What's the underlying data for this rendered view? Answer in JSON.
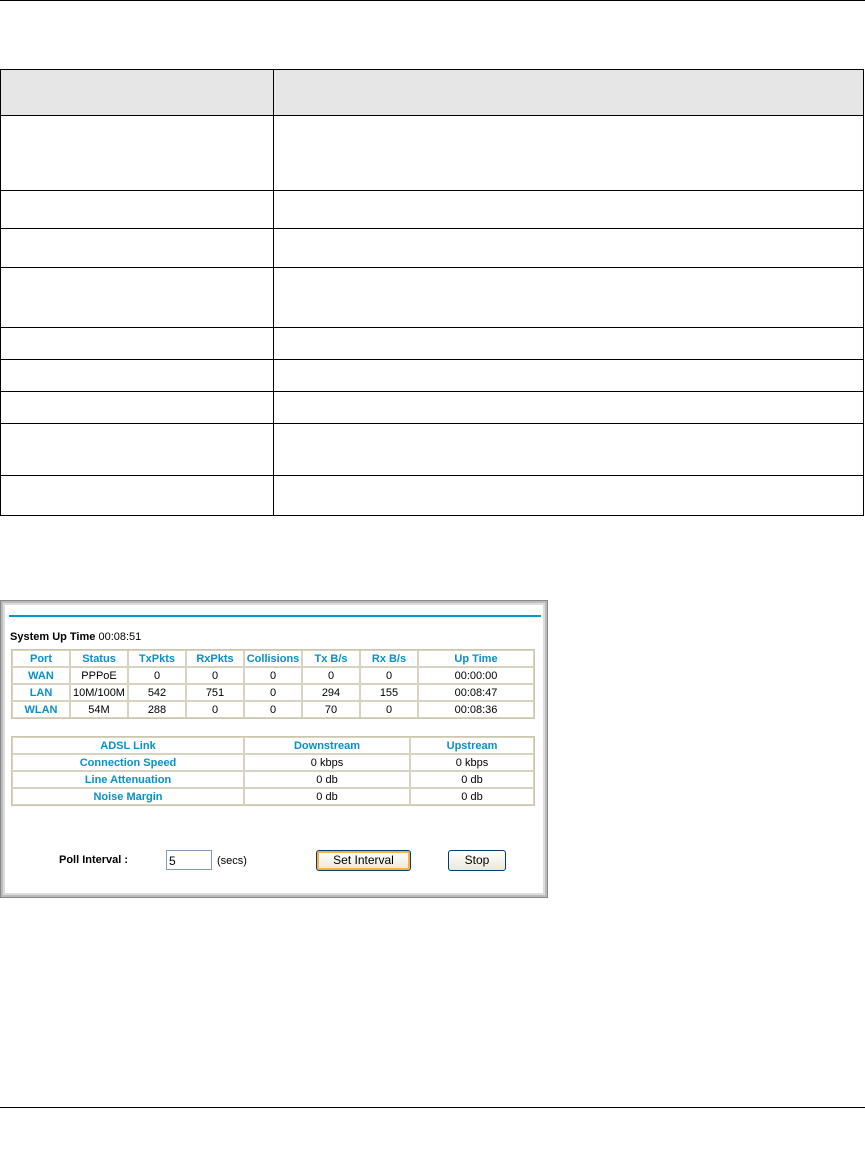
{
  "doc_table": {
    "rows": [
      [
        "",
        ""
      ],
      [
        "",
        ""
      ],
      [
        "",
        ""
      ],
      [
        "",
        ""
      ],
      [
        "",
        ""
      ],
      [
        "",
        ""
      ],
      [
        "",
        ""
      ],
      [
        "",
        ""
      ],
      [
        "",
        ""
      ],
      [
        "",
        ""
      ]
    ]
  },
  "screen": {
    "uptime_label": "System Up Time",
    "uptime_value": "00:08:51",
    "ports": {
      "headers": [
        "Port",
        "Status",
        "TxPkts",
        "RxPkts",
        "Collisions",
        "Tx B/s",
        "Rx B/s",
        "Up Time"
      ],
      "rows": [
        [
          "WAN",
          "PPPoE",
          "0",
          "0",
          "0",
          "0",
          "0",
          "00:00:00"
        ],
        [
          "LAN",
          "10M/100M",
          "542",
          "751",
          "0",
          "294",
          "155",
          "00:08:47"
        ],
        [
          "WLAN",
          "54M",
          "288",
          "0",
          "0",
          "70",
          "0",
          "00:08:36"
        ]
      ]
    },
    "adsl": {
      "headers": [
        "ADSL Link",
        "Downstream",
        "Upstream"
      ],
      "rows": [
        [
          "Connection Speed",
          "0 kbps",
          "0 kbps"
        ],
        [
          "Line Attenuation",
          "0 db",
          "0 db"
        ],
        [
          "Noise Margin",
          "0 db",
          "0 db"
        ]
      ]
    },
    "poll_label": "Poll Interval :",
    "poll_value": "5",
    "poll_unit": "(secs)",
    "set_interval": "Set Interval",
    "stop": "Stop",
    "accent": "#0099cc"
  }
}
